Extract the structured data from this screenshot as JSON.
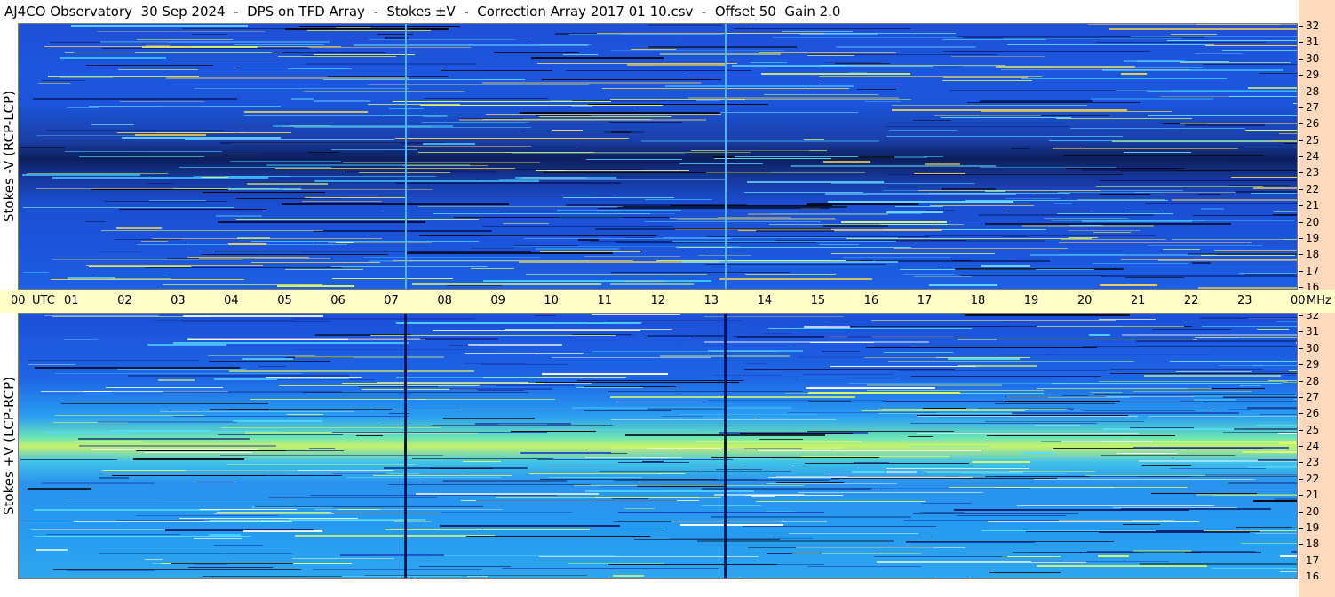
{
  "header": {
    "title": "AJ4CO Observatory  30 Sep 2024  -  DPS on TFD Array  -  Stokes ±V  -  Correction Array 2017 01 10.csv  -  Offset 50  Gain 2.0"
  },
  "panels": {
    "top_label": "Stokes -V (RCP-LCP)",
    "bottom_label": "Stokes +V (LCP-RCP)"
  },
  "colors": {
    "time_axis_bg": "#ffffc8",
    "freq_axis_bg": "#ffd9bd"
  },
  "chart_data": {
    "type": "heatmap",
    "title": "AJ4CO Observatory  30 Sep 2024  -  DPS on TFD Array  -  Stokes ±V  -  Correction Array 2017 01 10.csv  -  Offset 50  Gain 2.0",
    "x_unit_label": "UTC",
    "y_unit_label": "MHz",
    "x_tick_labels": [
      "00",
      "01",
      "02",
      "03",
      "04",
      "05",
      "06",
      "07",
      "08",
      "09",
      "10",
      "11",
      "12",
      "13",
      "14",
      "15",
      "16",
      "17",
      "18",
      "19",
      "20",
      "21",
      "22",
      "23",
      "00"
    ],
    "xlim": [
      0,
      24
    ],
    "y_tick_labels": [
      "32",
      "31",
      "30",
      "29",
      "28",
      "27",
      "26",
      "25",
      "24",
      "23",
      "22",
      "21",
      "20",
      "19",
      "18",
      "17",
      "16"
    ],
    "ylim": [
      16,
      32
    ],
    "panels": [
      "Stokes -V (RCP-LCP)",
      "Stokes +V (LCP-RCP)"
    ]
  }
}
